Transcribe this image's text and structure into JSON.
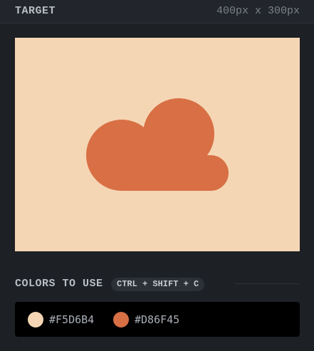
{
  "header": {
    "title": "TARGET",
    "size_label": "400px x 300px"
  },
  "target": {
    "background_color": "#F5D6B4",
    "shape_color": "#D86F45",
    "shape": "cloud"
  },
  "palette": {
    "label": "COLORS TO USE",
    "shortcut": "CTRL + SHIFT + C",
    "colors": [
      {
        "hex": "#F5D6B4",
        "label": "#F5D6B4"
      },
      {
        "hex": "#D86F45",
        "label": "#D86F45"
      }
    ]
  }
}
